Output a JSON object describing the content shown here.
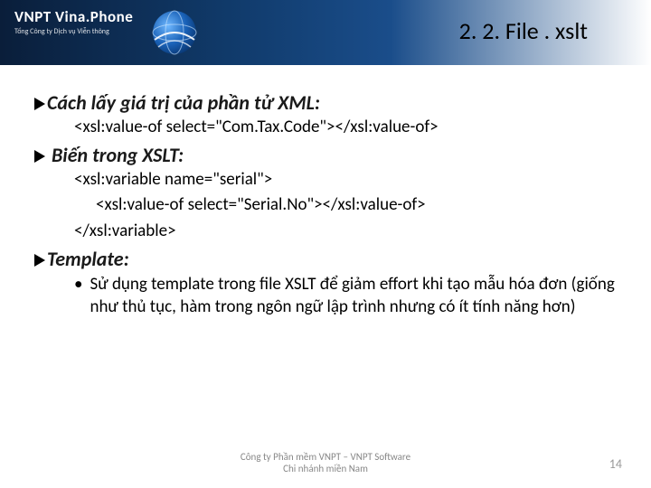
{
  "header": {
    "logo_main": "VNPT Vina.Phone",
    "logo_sub": "Tổng Công ty Dịch vụ Viễn thông",
    "title": "2. 2. File . xslt"
  },
  "sections": {
    "s1": {
      "heading": "Cách lấy giá trị của phần tử XML:",
      "code1": "<xsl:value-of select=\"Com.Tax.Code\"></xsl:value-of>"
    },
    "s2": {
      "heading": " Biến trong XSLT:",
      "code1": "<xsl:variable name=\"serial\">",
      "code2": "<xsl:value-of select=\"Serial.No\"></xsl:value-of>",
      "code3": "</xsl:variable>"
    },
    "s3": {
      "heading": "Template:",
      "bullet": "Sử dụng template trong file XSLT để giảm effort khi tạo mẫu hóa đơn (giống như thủ tục, hàm trong ngôn ngữ lập trình nhưng có ít tính  năng hơn)"
    }
  },
  "footer": {
    "line1": "Công ty Phần mềm VNPT – VNPT Software",
    "line2": "Chi nhánh miền Nam"
  },
  "page_number": "14"
}
